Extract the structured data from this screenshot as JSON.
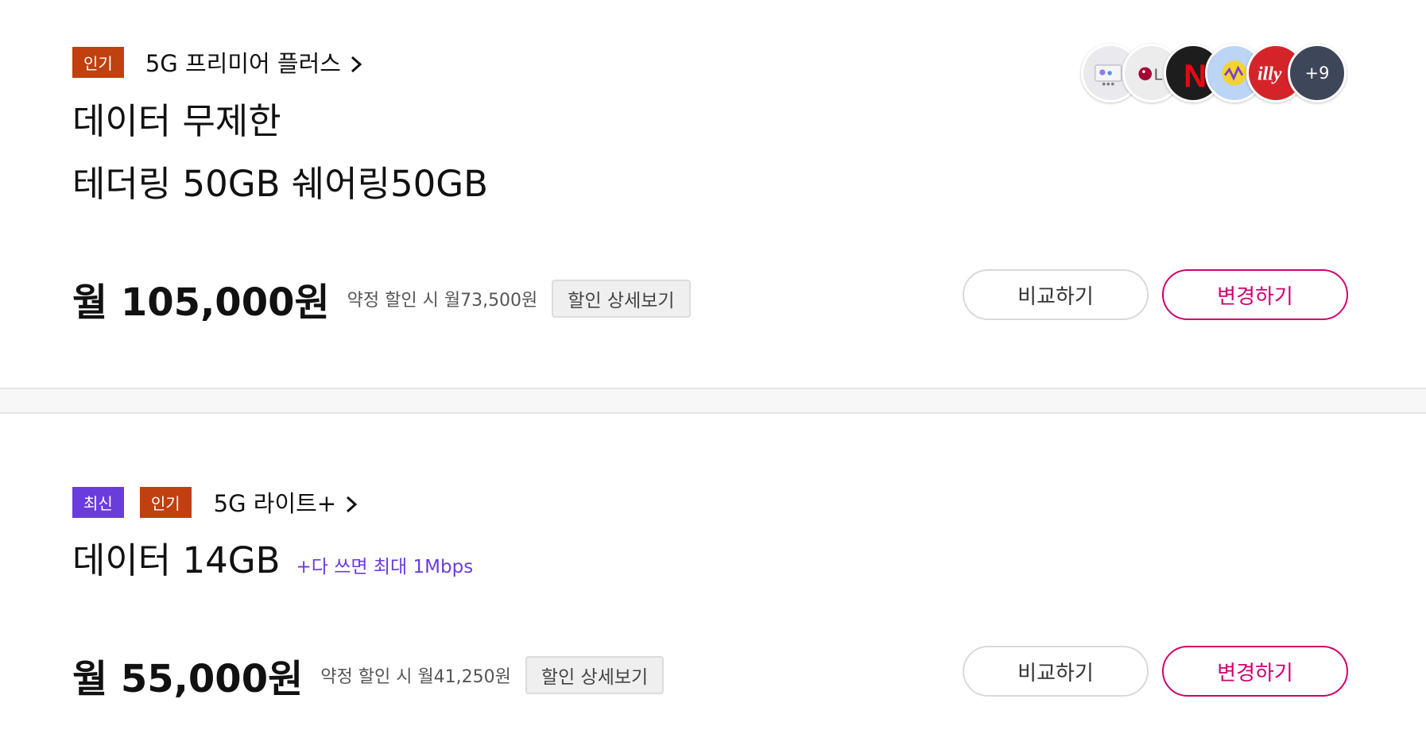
{
  "colors": {
    "popular_badge": "#c0400f",
    "new_badge": "#6b3cdc",
    "accent": "#d0006f",
    "more_badge": "#3e4659"
  },
  "plans": [
    {
      "badges": [
        {
          "label": "인기",
          "color": "#c0400f"
        }
      ],
      "plan_name": "5G 프리미어 플러스",
      "title_line1": "데이터 무제한",
      "title_line2": "테더링 50GB 쉐어링50GB",
      "price": "월 105,000원",
      "discount_text": "약정 할인 시 월73,500원",
      "discount_button": "할인 상세보기",
      "compare_label": "비교하기",
      "change_label": "변경하기",
      "benefit_icons": [
        "screen-app-icon",
        "lg-logo-icon",
        "netflix-icon",
        "music-app-icon",
        "illy-logo-icon"
      ],
      "more_benefits": "+9"
    },
    {
      "badges": [
        {
          "label": "최신",
          "color": "#6b3cdc"
        },
        {
          "label": "인기",
          "color": "#c0400f"
        }
      ],
      "plan_name": "5G 라이트+",
      "title": "데이터 14GB",
      "title_note": "+다 쓰면 최대 1Mbps",
      "price": "월 55,000원",
      "discount_text": "약정 할인 시 월41,250원",
      "discount_button": "할인 상세보기",
      "compare_label": "비교하기",
      "change_label": "변경하기"
    }
  ]
}
